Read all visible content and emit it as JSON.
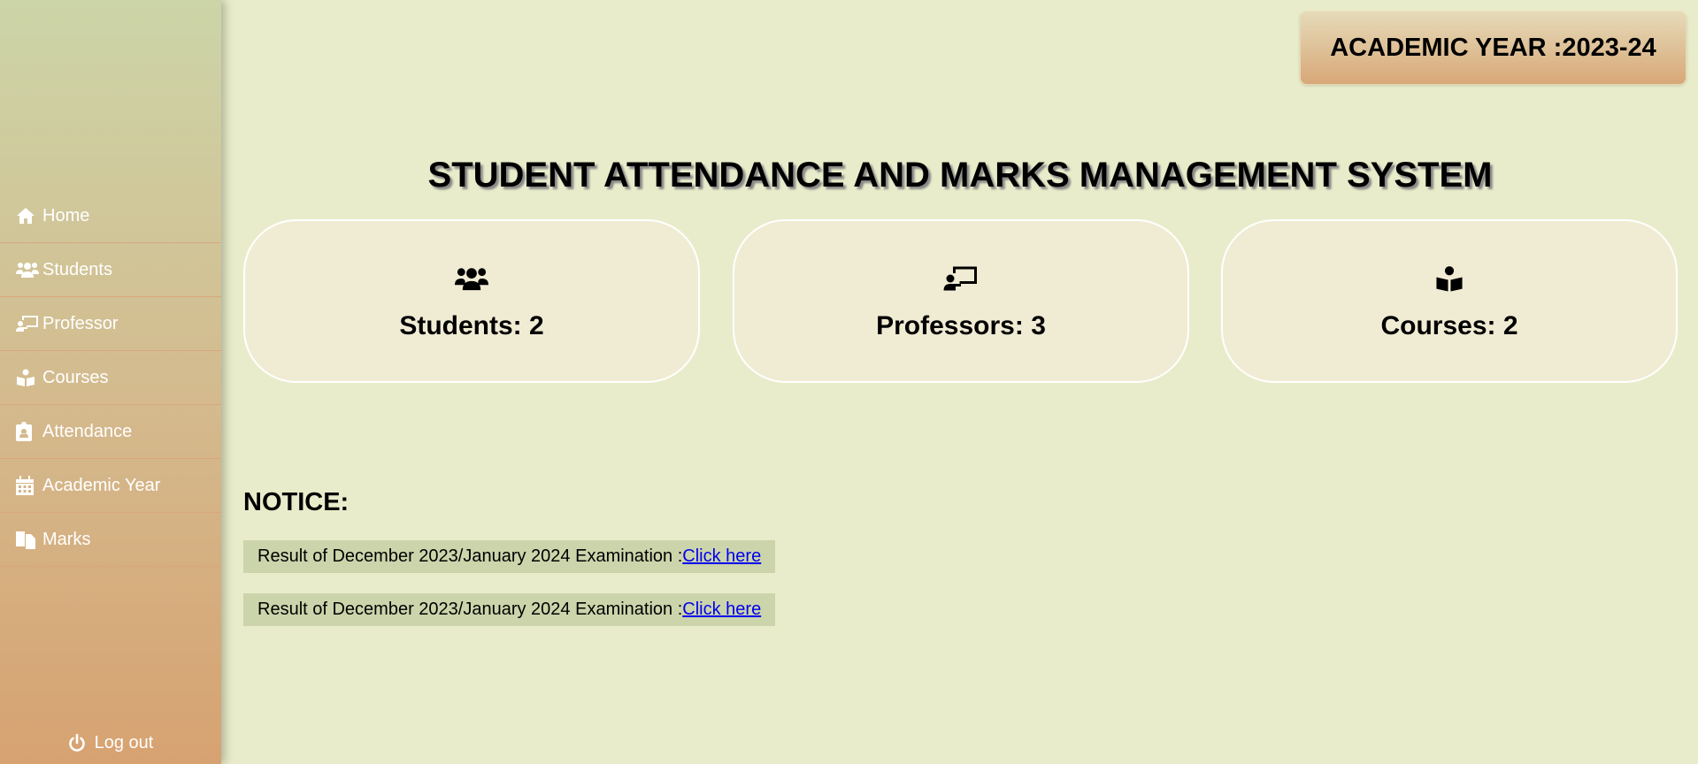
{
  "sidebar": {
    "items": [
      {
        "label": "Home",
        "icon": "home-icon"
      },
      {
        "label": "Students",
        "icon": "users-icon"
      },
      {
        "label": "Professor",
        "icon": "chalkboard-teacher-icon"
      },
      {
        "label": "Courses",
        "icon": "book-reader-icon"
      },
      {
        "label": "Attendance",
        "icon": "clipboard-user-icon"
      },
      {
        "label": "Academic Year",
        "icon": "calendar-icon"
      },
      {
        "label": "Marks",
        "icon": "copy-icon"
      }
    ],
    "logout_label": "Log out"
  },
  "header": {
    "academic_year": "ACADEMIC YEAR :2023-24"
  },
  "title": "STUDENT ATTENDANCE AND MARKS MANAGEMENT SYSTEM",
  "cards": [
    {
      "label": "Students: 2",
      "icon": "users-icon"
    },
    {
      "label": "Professors: 3",
      "icon": "chalkboard-teacher-icon"
    },
    {
      "label": "Courses: 2",
      "icon": "book-reader-icon"
    }
  ],
  "notice": {
    "heading": "NOTICE:",
    "items": [
      {
        "text": "Result of December 2023/January 2024 Examination :",
        "link": "Click here"
      },
      {
        "text": "Result of December 2023/January 2024 Examination :",
        "link": "Click here"
      }
    ]
  },
  "colors": {
    "background": "#e9ecca",
    "card": "#f0ebd3",
    "notice_bg": "#ccd4ab",
    "link": "#0000ee"
  }
}
